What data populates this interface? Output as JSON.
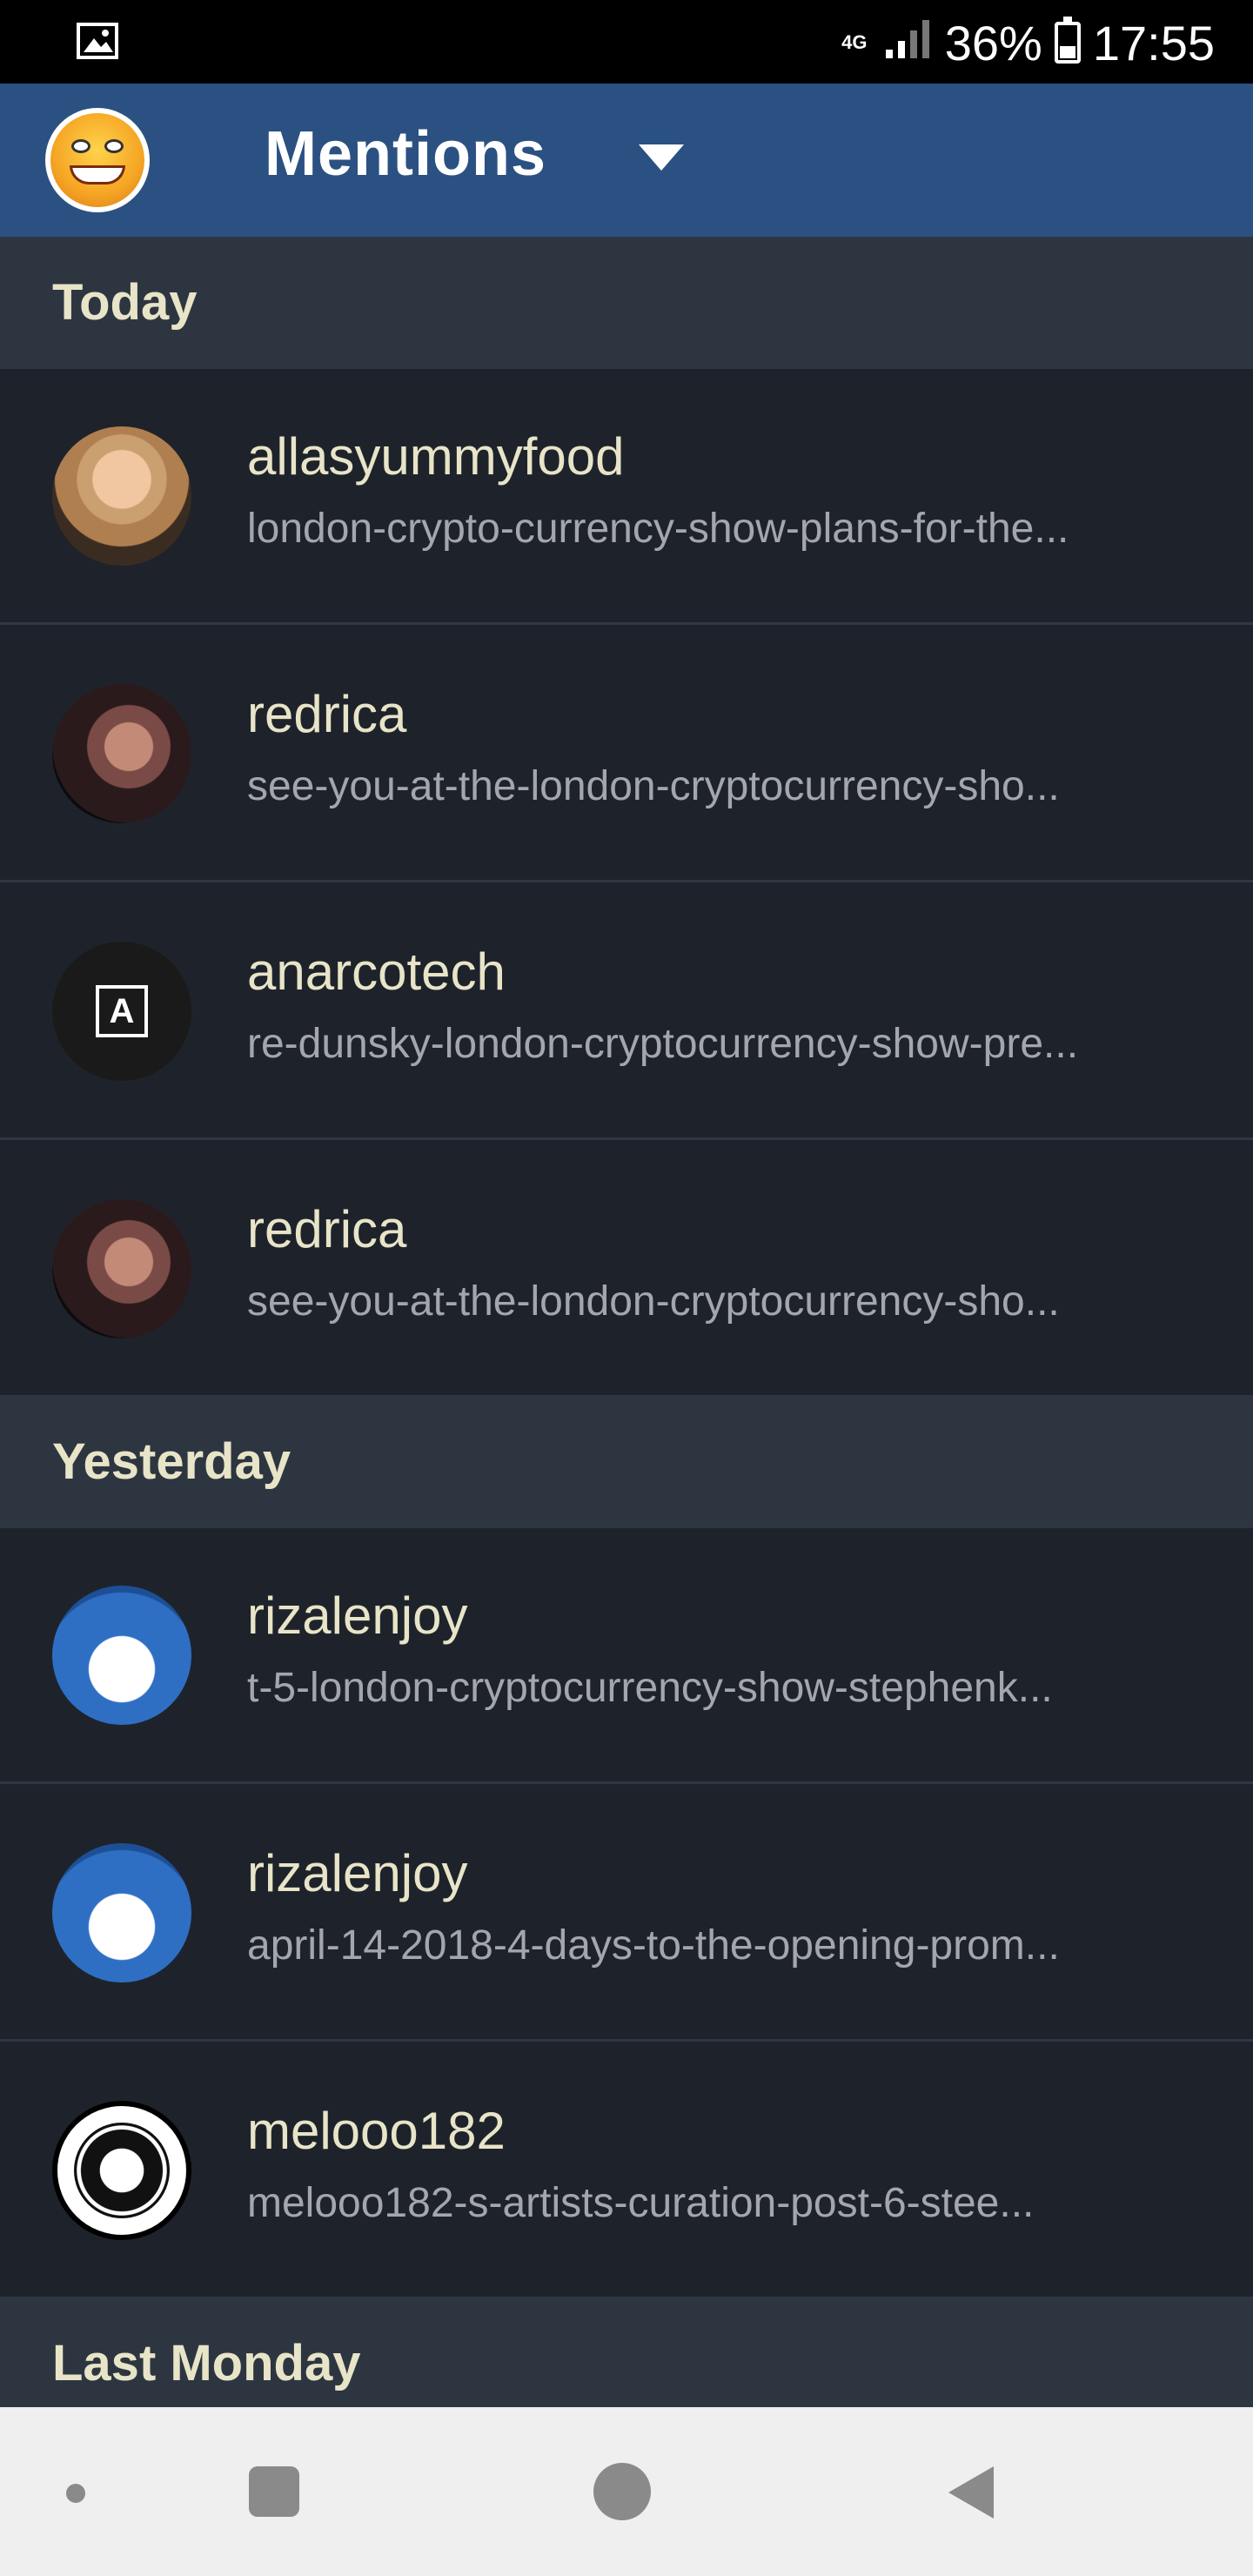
{
  "status_bar": {
    "network": "4G",
    "battery": "36%",
    "time": "17:55"
  },
  "app_bar": {
    "title": "Mentions"
  },
  "sections": [
    {
      "label": "Today",
      "items": [
        {
          "user": "allasyummyfood",
          "slug": "london-crypto-currency-show-plans-for-the..."
        },
        {
          "user": "redrica",
          "slug": "see-you-at-the-london-cryptocurrency-sho..."
        },
        {
          "user": "anarcotech",
          "slug": "re-dunsky-london-cryptocurrency-show-pre..."
        },
        {
          "user": "redrica",
          "slug": "see-you-at-the-london-cryptocurrency-sho..."
        }
      ]
    },
    {
      "label": "Yesterday",
      "items": [
        {
          "user": "rizalenjoy",
          "slug": "t-5-london-cryptocurrency-show-stephenk..."
        },
        {
          "user": "rizalenjoy",
          "slug": "april-14-2018-4-days-to-the-opening-prom..."
        },
        {
          "user": "melooo182",
          "slug": "melooo182-s-artists-curation-post-6-stee..."
        }
      ]
    },
    {
      "label": "Last Monday",
      "items": []
    }
  ],
  "colors": {
    "app_bar": "#2b5182",
    "background": "#1e232b",
    "section_header": "#2d3640"
  }
}
